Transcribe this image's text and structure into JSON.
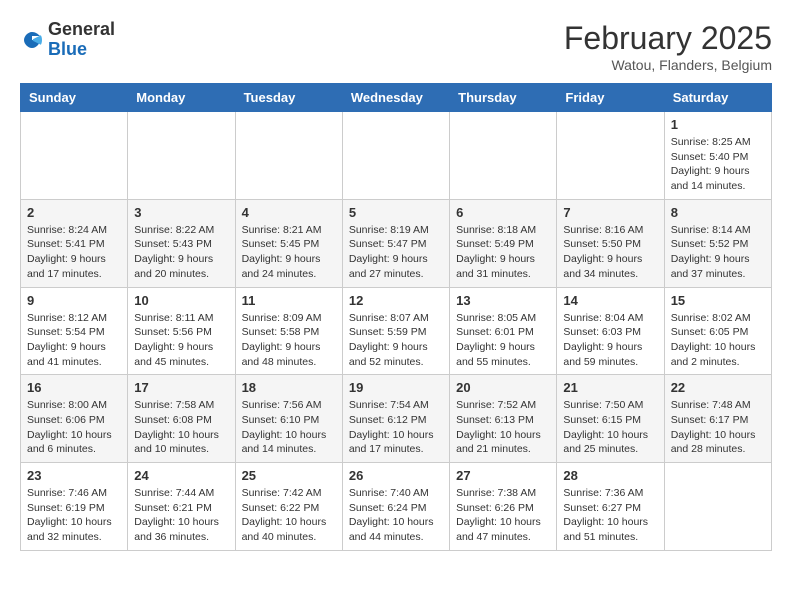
{
  "header": {
    "logo_general": "General",
    "logo_blue": "Blue",
    "month_title": "February 2025",
    "location": "Watou, Flanders, Belgium"
  },
  "days_of_week": [
    "Sunday",
    "Monday",
    "Tuesday",
    "Wednesday",
    "Thursday",
    "Friday",
    "Saturday"
  ],
  "weeks": [
    [
      {
        "day": "",
        "info": ""
      },
      {
        "day": "",
        "info": ""
      },
      {
        "day": "",
        "info": ""
      },
      {
        "day": "",
        "info": ""
      },
      {
        "day": "",
        "info": ""
      },
      {
        "day": "",
        "info": ""
      },
      {
        "day": "1",
        "info": "Sunrise: 8:25 AM\nSunset: 5:40 PM\nDaylight: 9 hours and 14 minutes."
      }
    ],
    [
      {
        "day": "2",
        "info": "Sunrise: 8:24 AM\nSunset: 5:41 PM\nDaylight: 9 hours and 17 minutes."
      },
      {
        "day": "3",
        "info": "Sunrise: 8:22 AM\nSunset: 5:43 PM\nDaylight: 9 hours and 20 minutes."
      },
      {
        "day": "4",
        "info": "Sunrise: 8:21 AM\nSunset: 5:45 PM\nDaylight: 9 hours and 24 minutes."
      },
      {
        "day": "5",
        "info": "Sunrise: 8:19 AM\nSunset: 5:47 PM\nDaylight: 9 hours and 27 minutes."
      },
      {
        "day": "6",
        "info": "Sunrise: 8:18 AM\nSunset: 5:49 PM\nDaylight: 9 hours and 31 minutes."
      },
      {
        "day": "7",
        "info": "Sunrise: 8:16 AM\nSunset: 5:50 PM\nDaylight: 9 hours and 34 minutes."
      },
      {
        "day": "8",
        "info": "Sunrise: 8:14 AM\nSunset: 5:52 PM\nDaylight: 9 hours and 37 minutes."
      }
    ],
    [
      {
        "day": "9",
        "info": "Sunrise: 8:12 AM\nSunset: 5:54 PM\nDaylight: 9 hours and 41 minutes."
      },
      {
        "day": "10",
        "info": "Sunrise: 8:11 AM\nSunset: 5:56 PM\nDaylight: 9 hours and 45 minutes."
      },
      {
        "day": "11",
        "info": "Sunrise: 8:09 AM\nSunset: 5:58 PM\nDaylight: 9 hours and 48 minutes."
      },
      {
        "day": "12",
        "info": "Sunrise: 8:07 AM\nSunset: 5:59 PM\nDaylight: 9 hours and 52 minutes."
      },
      {
        "day": "13",
        "info": "Sunrise: 8:05 AM\nSunset: 6:01 PM\nDaylight: 9 hours and 55 minutes."
      },
      {
        "day": "14",
        "info": "Sunrise: 8:04 AM\nSunset: 6:03 PM\nDaylight: 9 hours and 59 minutes."
      },
      {
        "day": "15",
        "info": "Sunrise: 8:02 AM\nSunset: 6:05 PM\nDaylight: 10 hours and 2 minutes."
      }
    ],
    [
      {
        "day": "16",
        "info": "Sunrise: 8:00 AM\nSunset: 6:06 PM\nDaylight: 10 hours and 6 minutes."
      },
      {
        "day": "17",
        "info": "Sunrise: 7:58 AM\nSunset: 6:08 PM\nDaylight: 10 hours and 10 minutes."
      },
      {
        "day": "18",
        "info": "Sunrise: 7:56 AM\nSunset: 6:10 PM\nDaylight: 10 hours and 14 minutes."
      },
      {
        "day": "19",
        "info": "Sunrise: 7:54 AM\nSunset: 6:12 PM\nDaylight: 10 hours and 17 minutes."
      },
      {
        "day": "20",
        "info": "Sunrise: 7:52 AM\nSunset: 6:13 PM\nDaylight: 10 hours and 21 minutes."
      },
      {
        "day": "21",
        "info": "Sunrise: 7:50 AM\nSunset: 6:15 PM\nDaylight: 10 hours and 25 minutes."
      },
      {
        "day": "22",
        "info": "Sunrise: 7:48 AM\nSunset: 6:17 PM\nDaylight: 10 hours and 28 minutes."
      }
    ],
    [
      {
        "day": "23",
        "info": "Sunrise: 7:46 AM\nSunset: 6:19 PM\nDaylight: 10 hours and 32 minutes."
      },
      {
        "day": "24",
        "info": "Sunrise: 7:44 AM\nSunset: 6:21 PM\nDaylight: 10 hours and 36 minutes."
      },
      {
        "day": "25",
        "info": "Sunrise: 7:42 AM\nSunset: 6:22 PM\nDaylight: 10 hours and 40 minutes."
      },
      {
        "day": "26",
        "info": "Sunrise: 7:40 AM\nSunset: 6:24 PM\nDaylight: 10 hours and 44 minutes."
      },
      {
        "day": "27",
        "info": "Sunrise: 7:38 AM\nSunset: 6:26 PM\nDaylight: 10 hours and 47 minutes."
      },
      {
        "day": "28",
        "info": "Sunrise: 7:36 AM\nSunset: 6:27 PM\nDaylight: 10 hours and 51 minutes."
      },
      {
        "day": "",
        "info": ""
      }
    ]
  ]
}
